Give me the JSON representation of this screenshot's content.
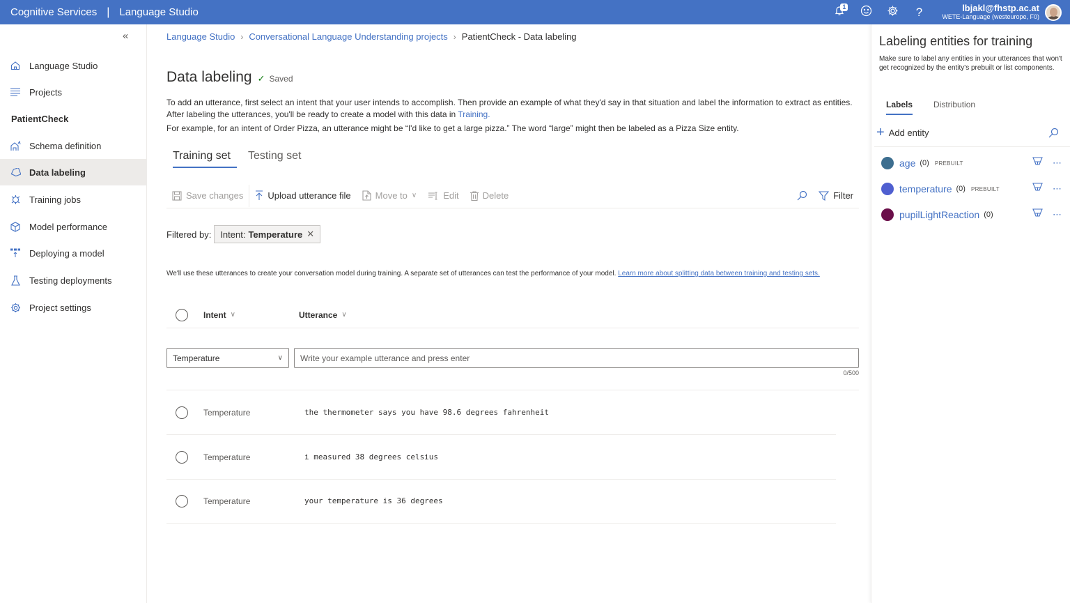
{
  "topbar": {
    "brand": "Cognitive Services",
    "separator": "|",
    "product": "Language Studio",
    "notification_count": "1",
    "user_email": "lbjakl@fhstp.ac.at",
    "user_resource": "WETE-Language (westeurope, F0)"
  },
  "sidebar": {
    "collapse_icon": "double-chevron-left-icon",
    "items_top": [
      {
        "label": "Language Studio",
        "icon": "home-icon"
      },
      {
        "label": "Projects",
        "icon": "list-icon"
      }
    ],
    "group_label": "PatientCheck",
    "items_project": [
      {
        "label": "Schema definition",
        "icon": "schema-icon",
        "active": false
      },
      {
        "label": "Data labeling",
        "icon": "tag-icon",
        "active": true
      },
      {
        "label": "Training jobs",
        "icon": "training-icon",
        "active": false
      },
      {
        "label": "Model performance",
        "icon": "cube-icon",
        "active": false
      },
      {
        "label": "Deploying a model",
        "icon": "deploy-icon",
        "active": false
      },
      {
        "label": "Testing deployments",
        "icon": "flask-icon",
        "active": false
      },
      {
        "label": "Project settings",
        "icon": "gear-icon",
        "active": false
      }
    ]
  },
  "breadcrumb": [
    {
      "label": "Language Studio",
      "link": true
    },
    {
      "label": "Conversational Language Understanding projects",
      "link": true
    },
    {
      "label": "PatientCheck - Data labeling",
      "link": false
    }
  ],
  "page": {
    "title": "Data labeling",
    "status": "Saved",
    "desc1_before": "To add an utterance, first select an intent that your user intends to accomplish. Then provide an example of what they'd say in that situation and label the information to extract as entities. After labeling the utterances, you'll be ready to create a model with this data in ",
    "desc1_link": "Training.",
    "desc2": "For example, for an intent of Order Pizza, an utterance might be “I'd like to get a large pizza.” The word “large” might then be labeled as a Pizza Size entity."
  },
  "tabs": [
    {
      "label": "Training set",
      "active": true
    },
    {
      "label": "Testing set",
      "active": false
    }
  ],
  "toolbar": {
    "save_changes": "Save changes",
    "upload": "Upload utterance file",
    "move_to": "Move to",
    "edit": "Edit",
    "delete": "Delete",
    "filter": "Filter"
  },
  "filter": {
    "label": "Filtered by:",
    "chip_key": "Intent:",
    "chip_value": "Temperature"
  },
  "info": {
    "text": "We'll use these utterances to create your conversation model during training. A separate set of utterances can test the performance of your model. ",
    "link": "Learn more about splitting data between training and testing sets."
  },
  "table": {
    "col_intent": "Intent",
    "col_utterance": "Utterance",
    "entry": {
      "intent_selected": "Temperature",
      "utterance_value": "",
      "utterance_placeholder": "Write your example utterance and press enter",
      "counter": "0/500"
    },
    "rows": [
      {
        "intent": "Temperature",
        "utterance": "the thermometer says you have 98.6 degrees fahrenheit"
      },
      {
        "intent": "Temperature",
        "utterance": "i measured 38 degrees celsius"
      },
      {
        "intent": "Temperature",
        "utterance": "your temperature is 36 degrees"
      }
    ]
  },
  "right_panel": {
    "title": "Labeling entities for training",
    "description": "Make sure to label any entities in your utterances that won't get recognized by the entity's prebuilt or list components.",
    "tabs": [
      {
        "label": "Labels",
        "active": true
      },
      {
        "label": "Distribution",
        "active": false
      }
    ],
    "add_entity": "Add entity",
    "entities": [
      {
        "name": "age",
        "count": "(0)",
        "tag": "PREBUILT",
        "color": "#3d6e8f"
      },
      {
        "name": "temperature",
        "count": "(0)",
        "tag": "PREBUILT",
        "color": "#4f5fd0"
      },
      {
        "name": "pupilLightReaction",
        "count": "(0)",
        "tag": "",
        "color": "#6b0f4a"
      }
    ]
  }
}
